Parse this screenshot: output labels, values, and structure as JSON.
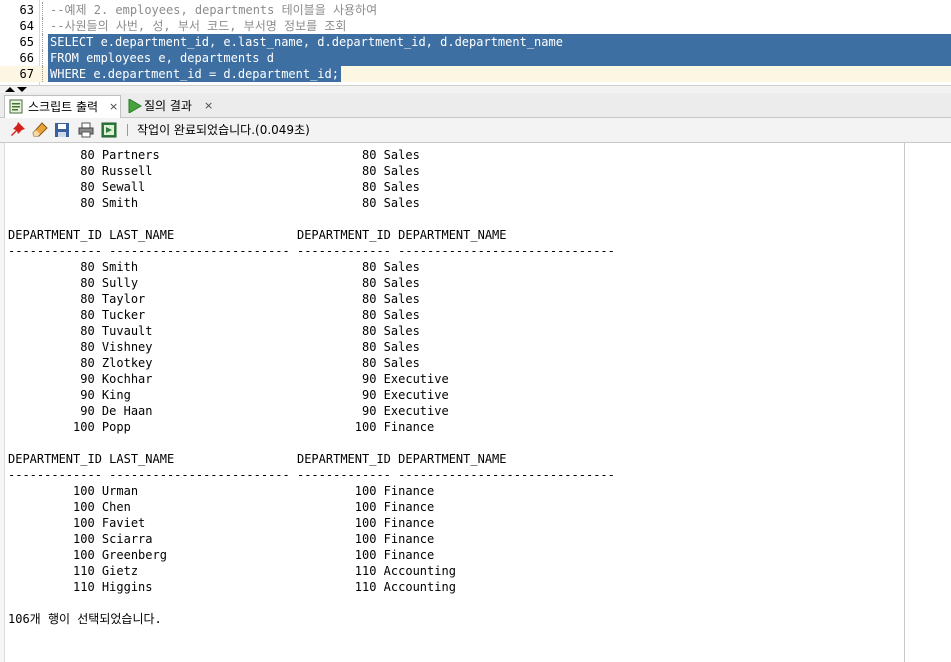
{
  "editor": {
    "lines": [
      {
        "num": "63",
        "text": "--예제 2. employees, departments 테이블을 사용하여",
        "kind": "comment"
      },
      {
        "num": "64",
        "text": "--사원들의 사번, 성, 부서 코드, 부서명 정보를 조회",
        "kind": "comment"
      },
      {
        "num": "65",
        "text": "SELECT e.department_id, e.last_name, d.department_id, d.department_name",
        "kind": "selected"
      },
      {
        "num": "66",
        "text": "FROM employees e, departments d",
        "kind": "selected"
      },
      {
        "num": "67",
        "text": "WHERE e.department_id = d.department_id;",
        "kind": "selected-current"
      }
    ]
  },
  "tabs": [
    {
      "label": "스크립트 출력",
      "close": "×",
      "active": true,
      "icon": "script-output-icon"
    },
    {
      "label": "질의 결과",
      "close": "×",
      "active": false,
      "icon": "run-triangle-icon"
    }
  ],
  "toolbar": {
    "icons": [
      "pin-icon",
      "eraser-icon",
      "save-icon",
      "print-icon",
      "export-icon"
    ],
    "status": "작업이 완료되었습니다.(0.049초)"
  },
  "output": {
    "lines": [
      "          80 Partners                            80 Sales",
      "          80 Russell                             80 Sales",
      "          80 Sewall                              80 Sales",
      "          80 Smith                               80 Sales",
      "",
      "DEPARTMENT_ID LAST_NAME                 DEPARTMENT_ID DEPARTMENT_NAME",
      "------------- ------------------------- ------------- ------------------------------",
      "          80 Smith                               80 Sales",
      "          80 Sully                               80 Sales",
      "          80 Taylor                              80 Sales",
      "          80 Tucker                              80 Sales",
      "          80 Tuvault                             80 Sales",
      "          80 Vishney                             80 Sales",
      "          80 Zlotkey                             80 Sales",
      "          90 Kochhar                             90 Executive",
      "          90 King                                90 Executive",
      "          90 De Haan                             90 Executive",
      "         100 Popp                               100 Finance",
      "",
      "DEPARTMENT_ID LAST_NAME                 DEPARTMENT_ID DEPARTMENT_NAME",
      "------------- ------------------------- ------------- ------------------------------",
      "         100 Urman                              100 Finance",
      "         100 Chen                               100 Finance",
      "         100 Faviet                             100 Finance",
      "         100 Sciarra                            100 Finance",
      "         100 Greenberg                          100 Finance",
      "         110 Gietz                              110 Accounting",
      "         110 Higgins                            110 Accounting",
      "",
      "106개 행이 선택되었습니다."
    ]
  },
  "colors": {
    "selection": "#3d6fa3",
    "comment": "#8c8c8c",
    "current_line": "#fdf6e3"
  }
}
